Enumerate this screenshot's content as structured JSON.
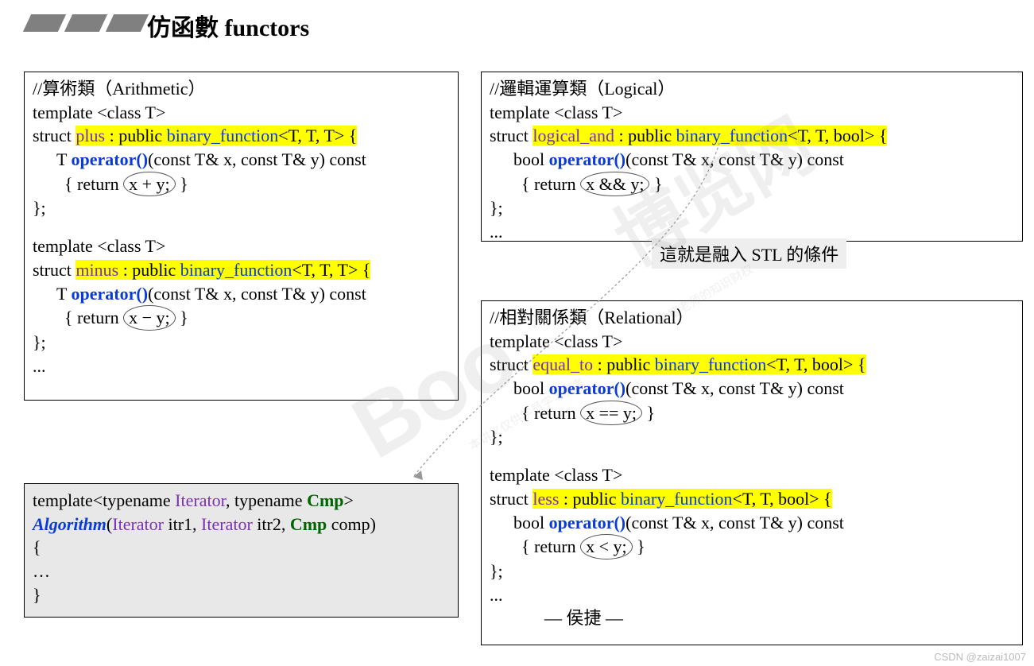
{
  "title": "仿函數 functors",
  "box_arith": {
    "comment": "//算術類（Arithmetic）",
    "tmpl": "template <class T>",
    "struct1_a": "struct ",
    "struct1_name": "plus",
    "struct1_b": " : public ",
    "struct1_bf": "binary_function",
    "struct1_c": "<T, T, T> {",
    "op_line1a": "T ",
    "op_kw": "operator()",
    "op_line1b": "(const T& x, const T& y) const",
    "ret_a": " { return ",
    "ret_expr1": "x + y;",
    "ret_b": " }",
    "close": "};",
    "struct2_name": "minus",
    "ret_expr2": "x − y;",
    "dots": "..."
  },
  "box_alg": {
    "l1a": "template<typename ",
    "l1b": "Iterator",
    "l1c": ", typename ",
    "l1d": "Cmp",
    "l1e": ">",
    "l2a": "Algorithm",
    "l2b": "(",
    "l2c": "Iterator",
    "l2d": " itr1, ",
    "l2e": "Iterator",
    "l2f": " itr2, ",
    "l2g": "Cmp",
    "l2h": " comp)",
    "l3": "{",
    "l4": "   …",
    "l5": "}"
  },
  "box_logical": {
    "comment": "//邏輯運算類（Logical）",
    "tmpl": "template <class T>",
    "struct_a": "struct ",
    "struct_name": "logical_and",
    "struct_b": " : public ",
    "struct_bf": "binary_function",
    "struct_c": "<T, T, bool> {",
    "op_line_a": "bool ",
    "op_kw": "operator()",
    "op_line_b": "(const T& x, const T& y) const",
    "ret_a": " { return ",
    "ret_expr": "x && y;",
    "ret_b": " }",
    "close": "};",
    "dots": "..."
  },
  "box_rel": {
    "comment": "//相對關係類（Relational）",
    "tmpl": "template <class T>",
    "struct1_name": "equal_to",
    "struct2_name": "less",
    "struct_b": " : public ",
    "struct_bf": "binary_function",
    "struct_c": "<T, T, bool> {",
    "op_line_a": "bool ",
    "op_kw": "operator()",
    "op_line_b": "(const T& x, const T& y) const",
    "ret_a": " { return ",
    "ret_expr1": "x == y;",
    "ret_expr2": "x < y;",
    "ret_b": " }",
    "close": "};",
    "dots": "..."
  },
  "note": "這就是融入 STL 的條件",
  "signature": "— 侯捷 —",
  "credit": "CSDN @zaizai1007"
}
